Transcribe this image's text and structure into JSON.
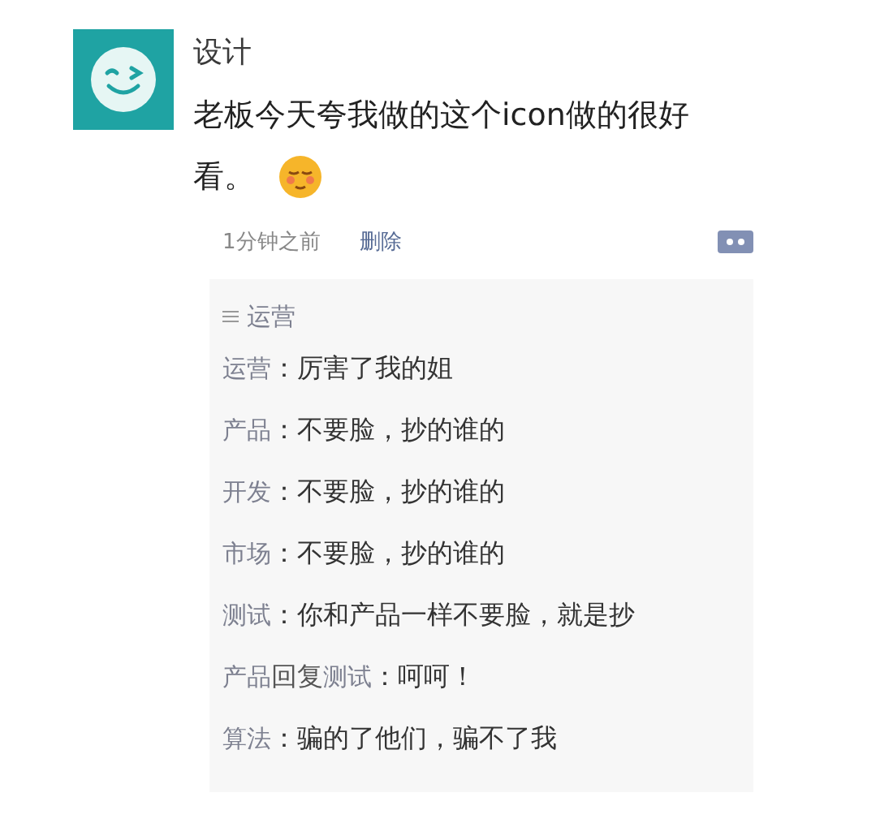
{
  "post": {
    "author": "设计",
    "text_lines": [
      "老板今天夸我做的这个icon做的很好",
      "看。"
    ],
    "time": "1分钟之前",
    "delete_label": "删除"
  },
  "likes": [
    "运营"
  ],
  "comments": [
    {
      "author": "运营",
      "text": "：厉害了我的姐"
    },
    {
      "author": "产品",
      "text": "：不要脸，抄的谁的"
    },
    {
      "author": "开发",
      "text": "：不要脸，抄的谁的"
    },
    {
      "author": "市场",
      "text": "：不要脸，抄的谁的"
    },
    {
      "author": "测试",
      "text": "：你和产品一样不要脸，就是抄"
    },
    {
      "author": "产品",
      "reply_label": "回复",
      "reply_to": "测试",
      "text": "：呵呵！"
    },
    {
      "author": "算法",
      "text": "：骗的了他们，骗不了我"
    }
  ]
}
